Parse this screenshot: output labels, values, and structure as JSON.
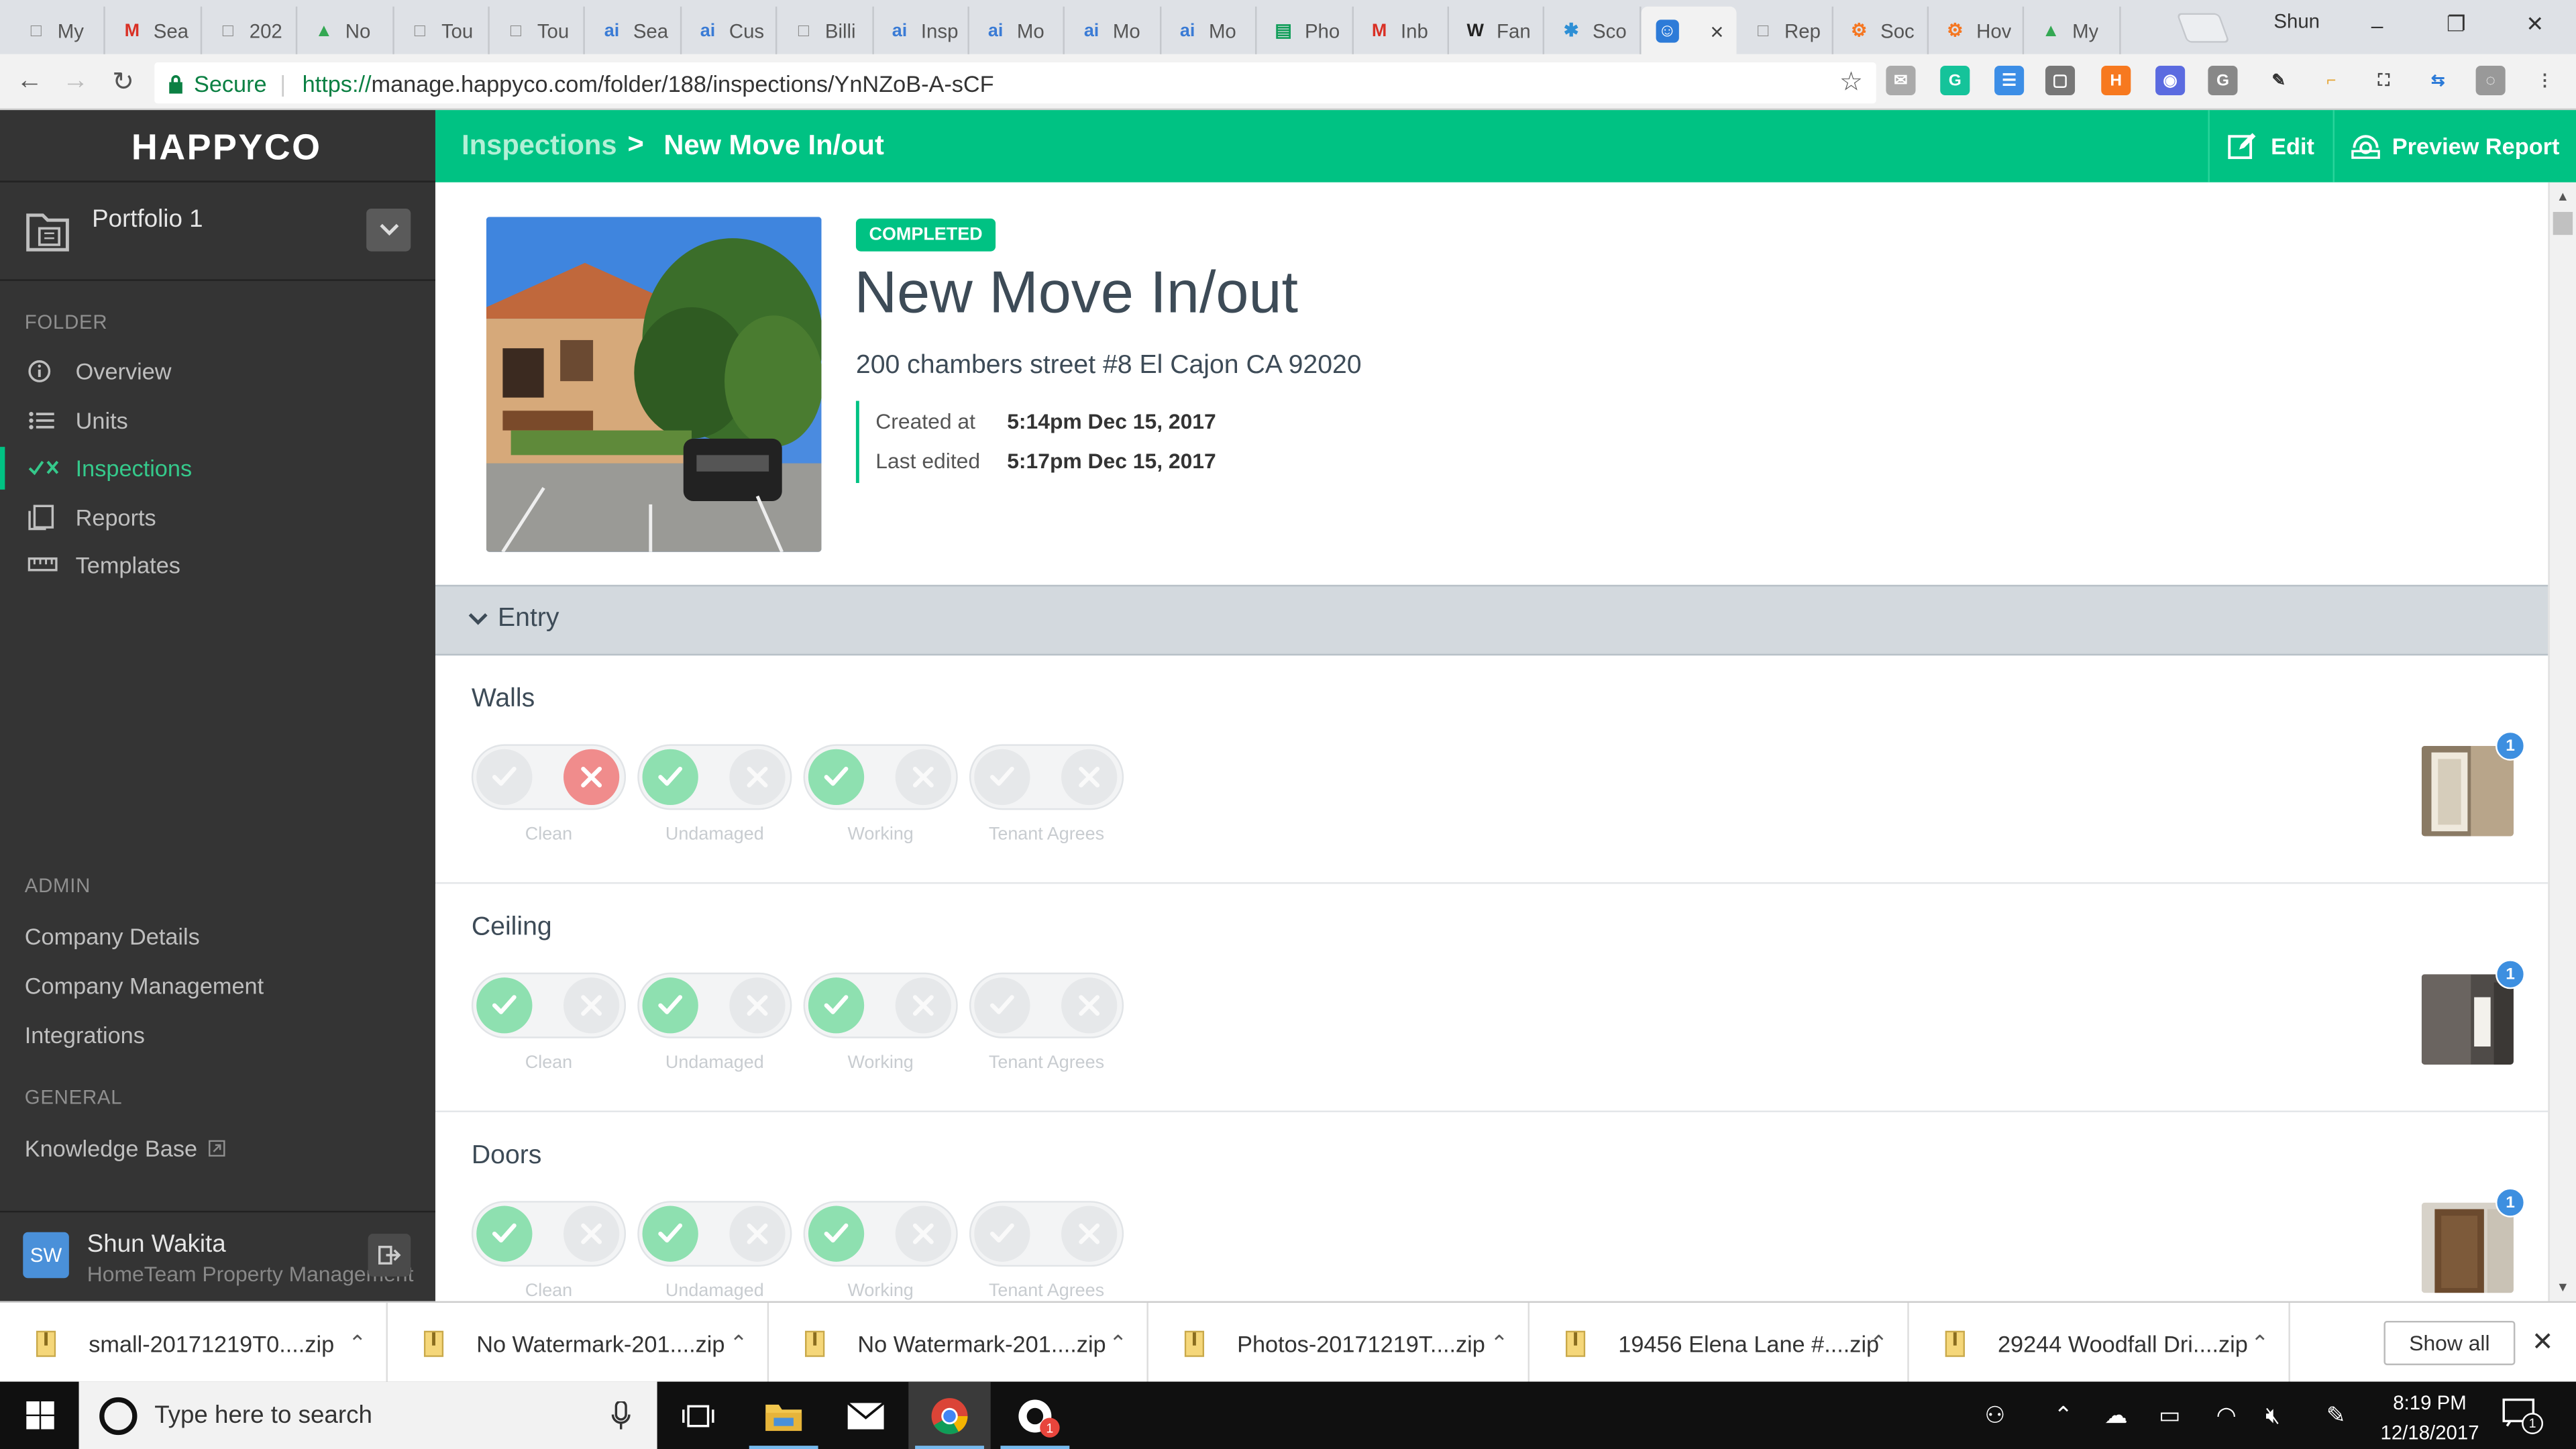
{
  "browser": {
    "tabs": [
      {
        "label": "My",
        "icon": "doc-icon"
      },
      {
        "label": "Sea",
        "icon": "gmail-icon"
      },
      {
        "label": "202",
        "icon": "doc-icon"
      },
      {
        "label": "No",
        "icon": "drive-icon"
      },
      {
        "label": "Tou",
        "icon": "doc-icon"
      },
      {
        "label": "Tou",
        "icon": "doc-icon"
      },
      {
        "label": "Sea",
        "icon": "ai-icon"
      },
      {
        "label": "Cus",
        "icon": "ai-icon"
      },
      {
        "label": "Billi",
        "icon": "doc-icon"
      },
      {
        "label": "Insp",
        "icon": "ai-icon"
      },
      {
        "label": "Mo",
        "icon": "ai-icon"
      },
      {
        "label": "Mo",
        "icon": "ai-icon"
      },
      {
        "label": "Mo",
        "icon": "ai-icon"
      },
      {
        "label": "Pho",
        "icon": "sheets-icon"
      },
      {
        "label": "Inb",
        "icon": "gmail-icon"
      },
      {
        "label": "Fan",
        "icon": "wikipedia-icon"
      },
      {
        "label": "Sco",
        "icon": "asterisk-icon"
      },
      {
        "label": "",
        "icon": "happyco-icon",
        "active": true
      },
      {
        "label": "Rep",
        "icon": "doc-icon"
      },
      {
        "label": "Soc",
        "icon": "hubspot-icon"
      },
      {
        "label": "Hov",
        "icon": "hubspot-icon"
      },
      {
        "label": "My",
        "icon": "drive-icon"
      }
    ],
    "profile_name": "Shun",
    "secure_label": "Secure",
    "url_scheme": "https://",
    "url_rest": "manage.happyco.com/folder/188/inspections/YnNZoB-A-sCF",
    "window_buttons": {
      "minimize": "–",
      "restore": "❐",
      "close": "✕"
    }
  },
  "sidebar": {
    "logo": "HAPPYCO",
    "portfolio": "Portfolio 1",
    "folder_heading": "FOLDER",
    "folder_items": [
      {
        "label": "Overview",
        "icon": "info-icon",
        "active": false
      },
      {
        "label": "Units",
        "icon": "list-icon",
        "active": false
      },
      {
        "label": "Inspections",
        "icon": "check-x-icon",
        "active": true
      },
      {
        "label": "Reports",
        "icon": "reports-icon",
        "active": false
      },
      {
        "label": "Templates",
        "icon": "ruler-icon",
        "active": false
      }
    ],
    "admin_heading": "ADMIN",
    "admin_items": [
      "Company Details",
      "Company Management",
      "Integrations"
    ],
    "general_heading": "GENERAL",
    "knowledge_base": "Knowledge Base",
    "user": {
      "initials": "SW",
      "name": "Shun Wakita",
      "company": "HomeTeam Property Management"
    }
  },
  "header": {
    "breadcrumb_parent": "Inspections",
    "breadcrumb_sep": ">",
    "breadcrumb_current": "New Move In/out",
    "edit_label": "Edit",
    "preview_label": "Preview Report",
    "accent": "#00c283"
  },
  "inspection": {
    "status": "COMPLETED",
    "title": "New Move In/out",
    "address": "200 chambers street #8 El Cajon CA 92020",
    "created_label": "Created at",
    "created_value": "5:14pm Dec 15, 2017",
    "edited_label": "Last edited",
    "edited_value": "5:17pm Dec 15, 2017"
  },
  "section": {
    "name": "Entry",
    "items": [
      {
        "name": "Walls",
        "photo_count": "1",
        "ratings": [
          {
            "label": "Clean",
            "value": "fail"
          },
          {
            "label": "Undamaged",
            "value": "pass"
          },
          {
            "label": "Working",
            "value": "pass"
          },
          {
            "label": "Tenant Agrees",
            "value": "none"
          }
        ]
      },
      {
        "name": "Ceiling",
        "photo_count": "1",
        "ratings": [
          {
            "label": "Clean",
            "value": "pass"
          },
          {
            "label": "Undamaged",
            "value": "pass"
          },
          {
            "label": "Working",
            "value": "pass"
          },
          {
            "label": "Tenant Agrees",
            "value": "none"
          }
        ]
      },
      {
        "name": "Doors",
        "photo_count": "1",
        "ratings": [
          {
            "label": "Clean",
            "value": "pass"
          },
          {
            "label": "Undamaged",
            "value": "pass"
          },
          {
            "label": "Working",
            "value": "pass"
          },
          {
            "label": "Tenant Agrees",
            "value": "none"
          }
        ]
      }
    ],
    "colors": {
      "pass": "#8ee0b0",
      "fail": "#f08c8c",
      "off": "#e6e8ea"
    }
  },
  "downloads": {
    "files": [
      "small-20171219T0....zip",
      "No Watermark-201....zip",
      "No Watermark-201....zip",
      "Photos-20171219T....zip",
      "19456 Elena Lane #....zip",
      "29244 Woodfall Dri....zip"
    ],
    "show_all": "Show all"
  },
  "taskbar": {
    "search_placeholder": "Type here to search",
    "time": "8:19 PM",
    "date": "12/18/2017",
    "notification_count": "1",
    "app_badge": "1"
  }
}
